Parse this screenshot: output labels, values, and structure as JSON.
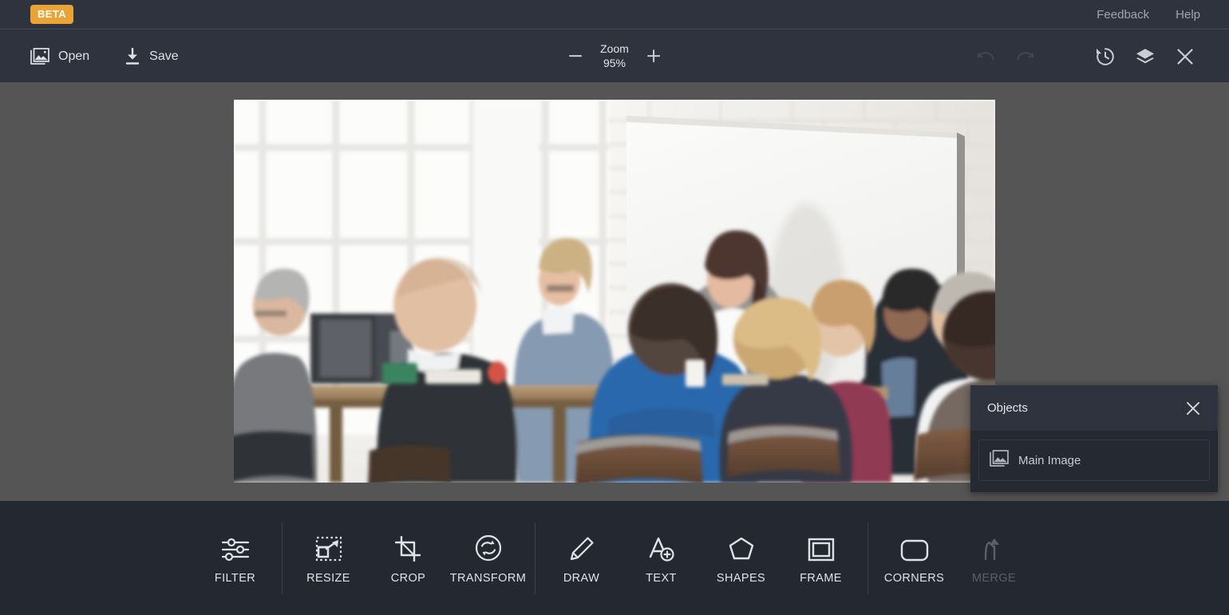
{
  "header": {
    "beta_badge": "BETA",
    "links": [
      {
        "label": "Feedback",
        "name": "feedback-link"
      },
      {
        "label": "Help",
        "name": "help-link"
      }
    ]
  },
  "toolbar": {
    "open_label": "Open",
    "save_label": "Save",
    "zoom": {
      "label": "Zoom",
      "value": "95%",
      "minus": "−",
      "plus": "+"
    },
    "actions": [
      {
        "name": "undo-button",
        "icon": "undo-icon",
        "enabled": false
      },
      {
        "name": "redo-button",
        "icon": "redo-icon",
        "enabled": false
      },
      {
        "name": "history-button",
        "icon": "history-icon",
        "enabled": true
      },
      {
        "name": "layers-button",
        "icon": "layers-icon",
        "enabled": true
      },
      {
        "name": "close-editor-button",
        "icon": "close-icon",
        "enabled": true
      }
    ]
  },
  "canvas": {
    "background_color": "#555555",
    "image_alt": "Business meeting presentation in bright office"
  },
  "objects_panel": {
    "title": "Objects",
    "close_icon": "close-icon",
    "items": [
      {
        "label": "Main Image",
        "icon": "image-icon"
      }
    ]
  },
  "bottom_toolbar": {
    "groups": [
      {
        "tools": [
          {
            "label": "FILTER",
            "icon": "sliders-icon",
            "enabled": true
          }
        ]
      },
      {
        "tools": [
          {
            "label": "RESIZE",
            "icon": "resize-icon",
            "enabled": true
          },
          {
            "label": "CROP",
            "icon": "crop-icon",
            "enabled": true
          },
          {
            "label": "TRANSFORM",
            "icon": "transform-icon",
            "enabled": true
          }
        ]
      },
      {
        "tools": [
          {
            "label": "DRAW",
            "icon": "pencil-icon",
            "enabled": true
          },
          {
            "label": "TEXT",
            "icon": "text-add-icon",
            "enabled": true
          },
          {
            "label": "SHAPES",
            "icon": "polygon-icon",
            "enabled": true
          },
          {
            "label": "FRAME",
            "icon": "frame-icon",
            "enabled": true
          }
        ]
      },
      {
        "tools": [
          {
            "label": "CORNERS",
            "icon": "rounded-rect-icon",
            "enabled": true
          },
          {
            "label": "MERGE",
            "icon": "merge-arrow-icon",
            "enabled": false
          }
        ]
      }
    ]
  },
  "colors": {
    "accent": "#eaa436",
    "chrome": "#2f333d",
    "bottom_bar": "#242831",
    "canvas": "#555555",
    "panel": "#252932"
  }
}
